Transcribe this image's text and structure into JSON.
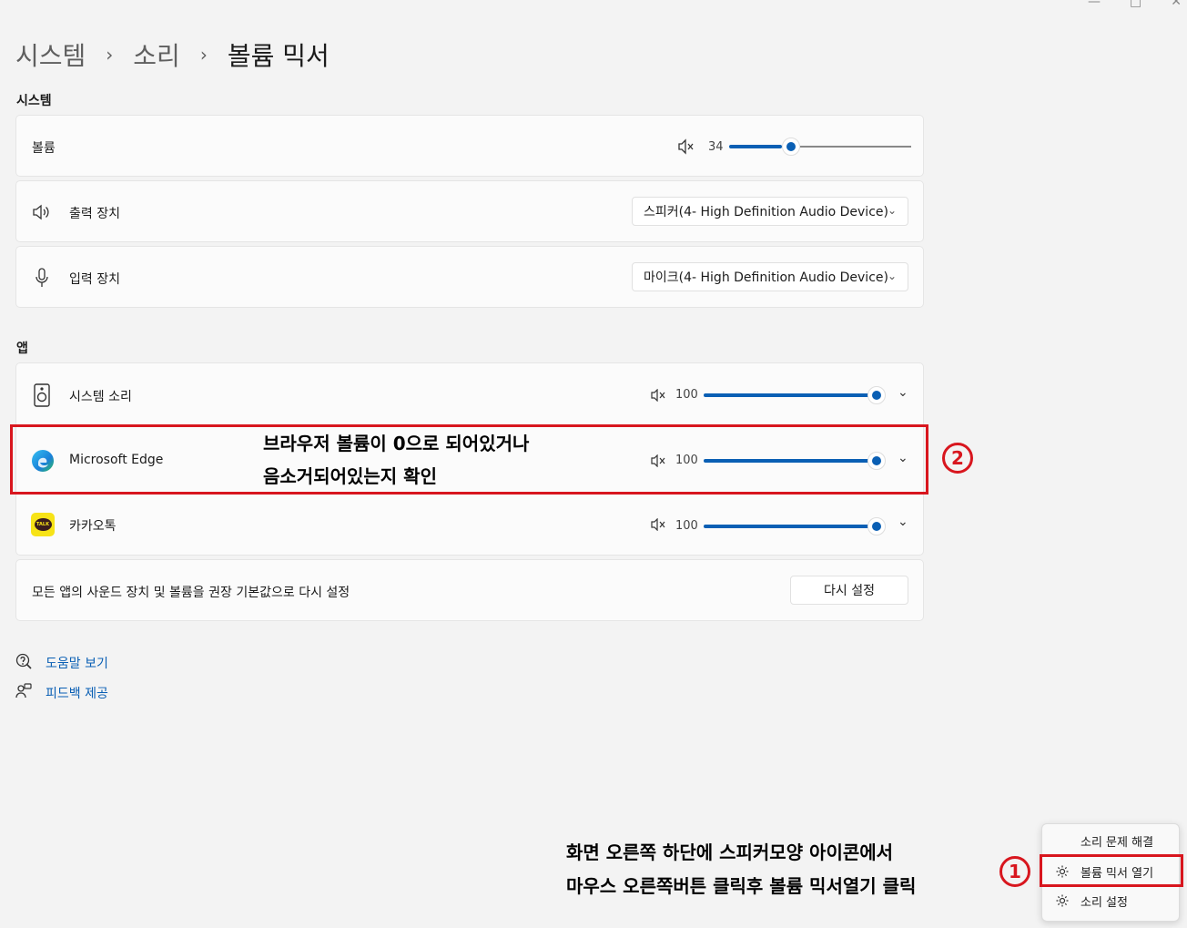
{
  "window": {
    "minimize_glyph": "—",
    "maximize_glyph": "□",
    "close_glyph": "✕"
  },
  "breadcrumb": {
    "items": [
      "시스템",
      "소리",
      "볼륨 믹서"
    ],
    "separator": "›"
  },
  "system_section": {
    "label": "시스템",
    "volume": {
      "label": "볼륨",
      "value": "34",
      "level": 0.34,
      "mute_icon": "speaker-muted-icon"
    },
    "output": {
      "label": "출력 장치",
      "icon": "speaker-icon",
      "selected": "스피커(4- High Definition Audio Device)"
    },
    "input": {
      "label": "입력 장치",
      "icon": "microphone-icon",
      "selected": "마이크(4- High Definition Audio Device)"
    }
  },
  "apps_section": {
    "label": "앱",
    "apps": [
      {
        "name": "시스템 소리",
        "icon": "system-sounds-icon",
        "volume": "100",
        "level": 1.0
      },
      {
        "name": "Microsoft Edge",
        "icon": "edge-icon",
        "volume": "100",
        "level": 1.0
      },
      {
        "name": "카카오톡",
        "icon": "kakaotalk-icon",
        "volume": "100",
        "level": 1.0,
        "icon_text": "TALK"
      }
    ],
    "reset_text": "모든 앱의 사운드 장치 및 볼륨을 권장 기본값으로 다시 설정",
    "reset_button": "다시 설정"
  },
  "links": [
    {
      "label": "도움말 보기",
      "icon": "help-icon"
    },
    {
      "label": "피드백 제공",
      "icon": "feedback-icon"
    }
  ],
  "tray_menu": {
    "items": [
      {
        "label": "소리 문제 해결",
        "icon": ""
      },
      {
        "label": "볼륨 믹서 열기",
        "icon": "gear-icon"
      },
      {
        "label": "소리 설정",
        "icon": "gear-icon"
      }
    ]
  },
  "annotations": {
    "step2_line1": "브라우저 볼륨이 0으로 되어있거나",
    "step2_line2": "음소거되어있는지 확인",
    "step2_number": "2",
    "step1_line1": "화면 오른쪽 하단에 스피커모양 아이콘에서",
    "step1_line2": "마우스 오른쪽버튼 클릭후 볼륨 믹서열기 클릭",
    "step1_number": "1",
    "highlight_color": "#d8161e"
  },
  "colors": {
    "accent": "#0a5fb4",
    "background": "#f3f3f3",
    "card": "#fbfbfb"
  }
}
